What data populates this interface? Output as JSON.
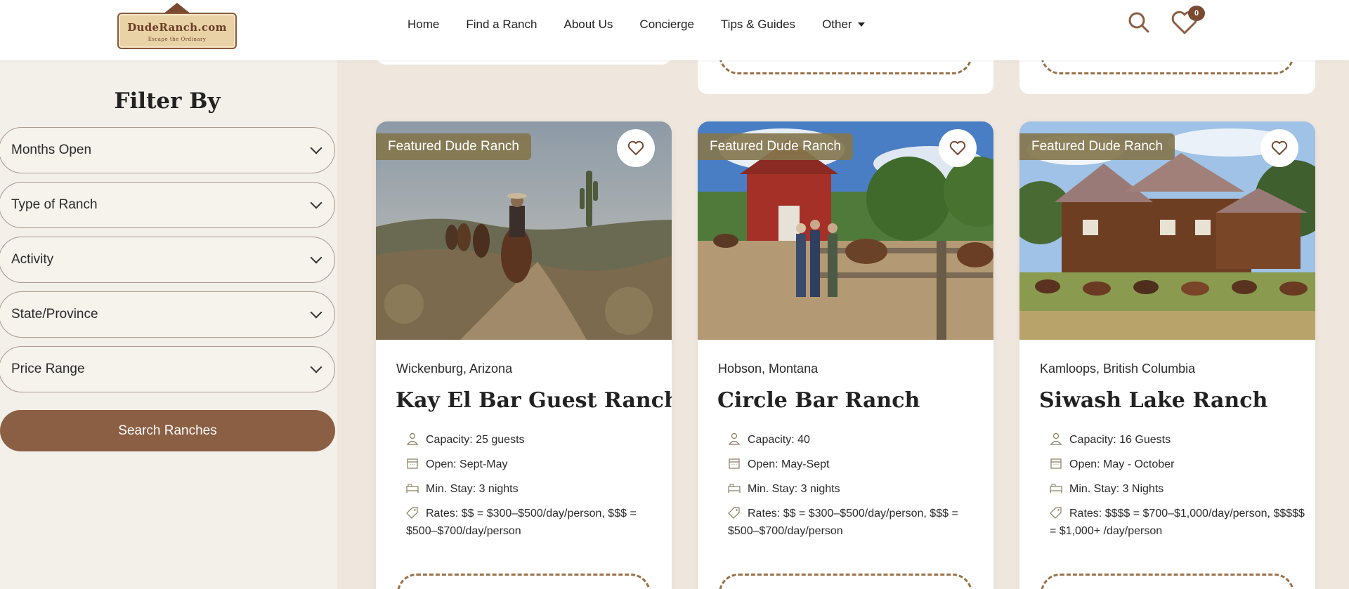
{
  "header": {
    "logo": {
      "brand": "DudeRanch.com",
      "tagline": "Escape the Ordinary"
    },
    "nav": [
      "Home",
      "Find a Ranch",
      "About Us",
      "Concierge",
      "Tips & Guides",
      "Other"
    ],
    "favorites_count": "0"
  },
  "sidebar": {
    "title": "Filter By",
    "filters": [
      "Months Open",
      "Type of Ranch",
      "Activity",
      "State/Province",
      "Price Range"
    ],
    "search_label": "Search Ranches"
  },
  "cards": [
    {
      "tag": "Featured Dude Ranch",
      "location": "Wickenburg, Arizona",
      "title": "Kay El Bar Guest Ranch",
      "capacity": "Capacity: 25 guests",
      "open": "Open: Sept-May",
      "min_stay": "Min. Stay: 3 nights",
      "rates": "Rates: $$ = $300–$500/day/person, $$$ = $500–$700/day/person"
    },
    {
      "tag": "Featured Dude Ranch",
      "location": "Hobson, Montana",
      "title": "Circle Bar Ranch",
      "capacity": "Capacity: 40",
      "open": "Open: May-Sept",
      "min_stay": "Min. Stay: 3 nights",
      "rates": "Rates: $$ = $300–$500/day/person, $$$ = $500–$700/day/person"
    },
    {
      "tag": "Featured Dude Ranch",
      "location": "Kamloops, British Columbia",
      "title": "Siwash Lake Ranch",
      "capacity": "Capacity: 16 Guests",
      "open": "Open: May - October",
      "min_stay": "Min. Stay: 3 Nights",
      "rates": "Rates: $$$$ = $700–$1,000/day/person, $$$$$ = $1,000+ /day/person"
    }
  ],
  "colors": {
    "brown": "#8b5f44",
    "tag": "#84764e",
    "dash": "#9a7148",
    "badge": "#7a4a32"
  }
}
